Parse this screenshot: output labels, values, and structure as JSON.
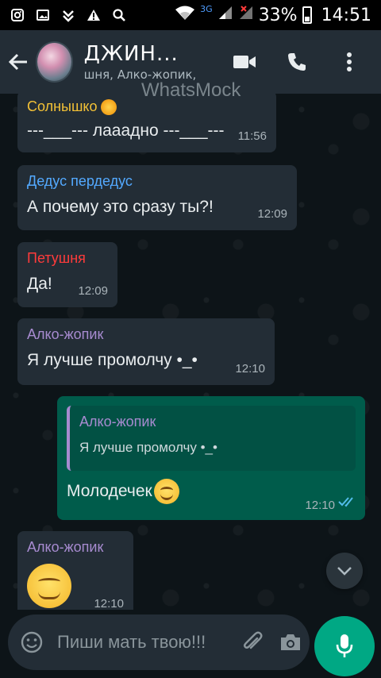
{
  "status_bar": {
    "network_label": "3G",
    "battery_percent": "33%",
    "time": "14:51"
  },
  "app_bar": {
    "title": "ДЖИН...",
    "subtitle": "шня, Алко-жопик,",
    "watermark": "WhatsMock"
  },
  "messages": [
    {
      "sender": "Солнышко",
      "sender_color": "#f3c136",
      "text": "---___--- лааадно ---___---",
      "time": "11:56"
    },
    {
      "sender": "Дедус пердедус",
      "sender_color": "#53a9ff",
      "text": "А почему это сразу ты?!",
      "time": "12:09"
    },
    {
      "sender": "Петушня",
      "sender_color": "#ff3b3b",
      "text": "Да!",
      "time": "12:09"
    },
    {
      "sender": "Алко-жопик",
      "sender_color": "#a78bd0",
      "text": "Я лучше промолчу •_•",
      "time": "12:10"
    },
    {
      "type": "outgoing",
      "reply_sender": "Алко-жопик",
      "reply_text": "Я лучше промолчу •_•",
      "text": "Молодечек",
      "time": "12:10",
      "status": "read"
    },
    {
      "sender": "Алко-жопик",
      "sender_color": "#a78bd0",
      "emoji": "smile",
      "time": "12:10"
    }
  ],
  "input": {
    "placeholder": "Пиши мать твою!!!"
  },
  "icons": {
    "back": "arrow-left-icon",
    "video": "video-call-icon",
    "call": "phone-icon",
    "menu": "more-vertical-icon",
    "emoji": "emoji-icon",
    "attach": "paperclip-icon",
    "camera": "camera-icon",
    "mic": "mic-icon",
    "scroll_down": "chevron-down-icon"
  },
  "colors": {
    "app_bar_bg": "#232d36",
    "incoming_bubble": "#232d36",
    "outgoing_bubble": "#005c4b",
    "accent": "#00a884"
  }
}
